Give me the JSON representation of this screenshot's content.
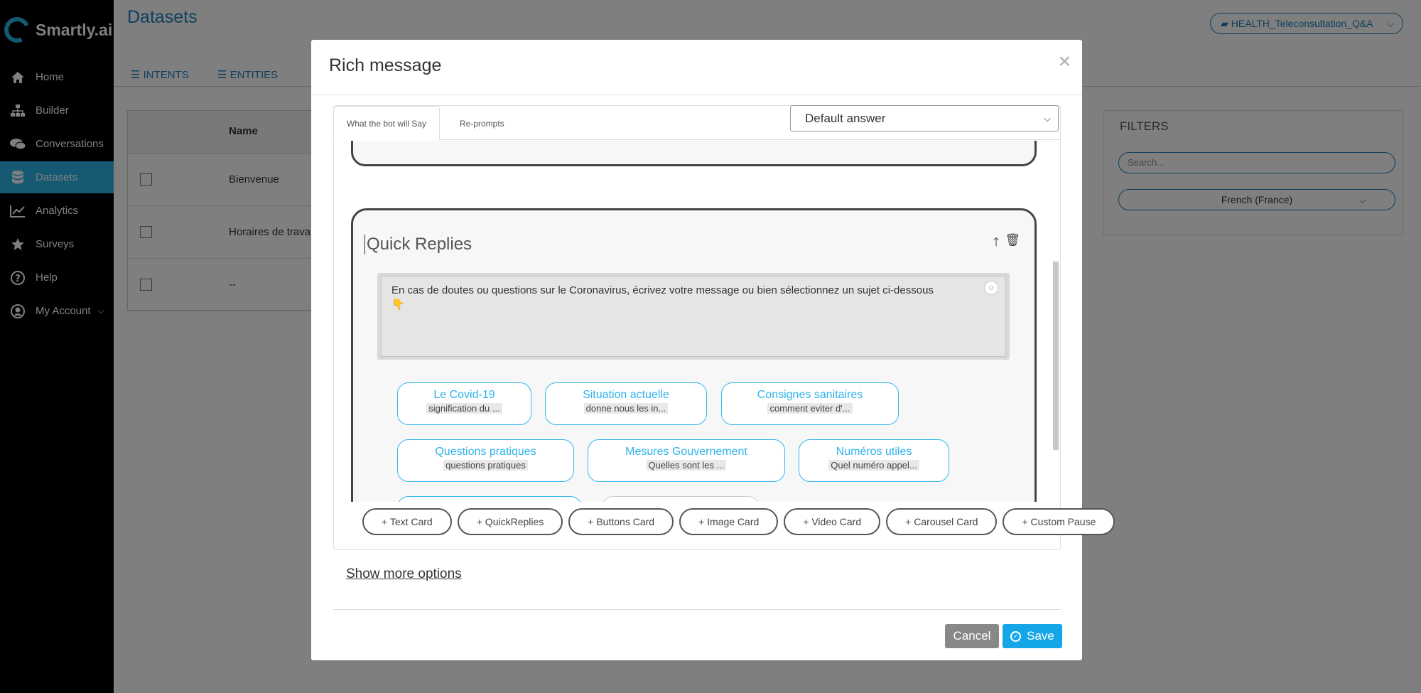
{
  "sidebar": {
    "logo_text": "Smartly.ai",
    "items": [
      {
        "label": "Home",
        "icon": "home-icon"
      },
      {
        "label": "Builder",
        "icon": "sitemap-icon"
      },
      {
        "label": "Conversations",
        "icon": "chat-icon"
      },
      {
        "label": "Datasets",
        "icon": "database-icon"
      },
      {
        "label": "Analytics",
        "icon": "chart-line-icon"
      },
      {
        "label": "Surveys",
        "icon": "star-icon"
      },
      {
        "label": "Help",
        "icon": "help-icon"
      },
      {
        "label": "My Account",
        "icon": "user-icon"
      }
    ]
  },
  "page": {
    "title": "Datasets",
    "project": "HEALTH_Teleconsultation_Q&A",
    "tabs": [
      "INTENTS",
      "ENTITIES"
    ],
    "table": {
      "header": "Name",
      "rows": [
        "Bienvenue",
        "Horaires de trava",
        "--"
      ]
    },
    "filters": {
      "title": "FILTERS",
      "search_placeholder": "Search...",
      "language": "French (France)"
    }
  },
  "modal": {
    "title": "Rich message",
    "close": "×",
    "tabs": [
      "What the bot will Say",
      "Re-prompts"
    ],
    "answer_select": "Default answer",
    "card": {
      "title": "Quick Replies",
      "message": "En cas de doutes ou questions sur le Coronavirus, écrivez votre message ou bien sélectionnez un sujet ci-dessous",
      "message_emoji": "👇",
      "quick_replies": [
        {
          "title": "Le Covid-19",
          "sub": "signification du ..."
        },
        {
          "title": "Situation actuelle",
          "sub": "donne nous les in..."
        },
        {
          "title": "Consignes sanitaires",
          "sub": "comment eviter d'..."
        },
        {
          "title": "Questions pratiques",
          "sub": "questions pratiques"
        },
        {
          "title": "Mesures Gouvernement",
          "sub": "Quelles sont les ..."
        },
        {
          "title": "Numéros utiles",
          "sub": "Quel numéro appel..."
        }
      ]
    },
    "add_buttons": [
      "+ Text Card",
      "+ QuickReplies",
      "+ Buttons Card",
      "+ Image Card",
      "+ Video Card",
      "+ Carousel Card",
      "+ Custom Pause"
    ],
    "show_more": "Show more options",
    "cancel": "Cancel",
    "save": "Save"
  }
}
